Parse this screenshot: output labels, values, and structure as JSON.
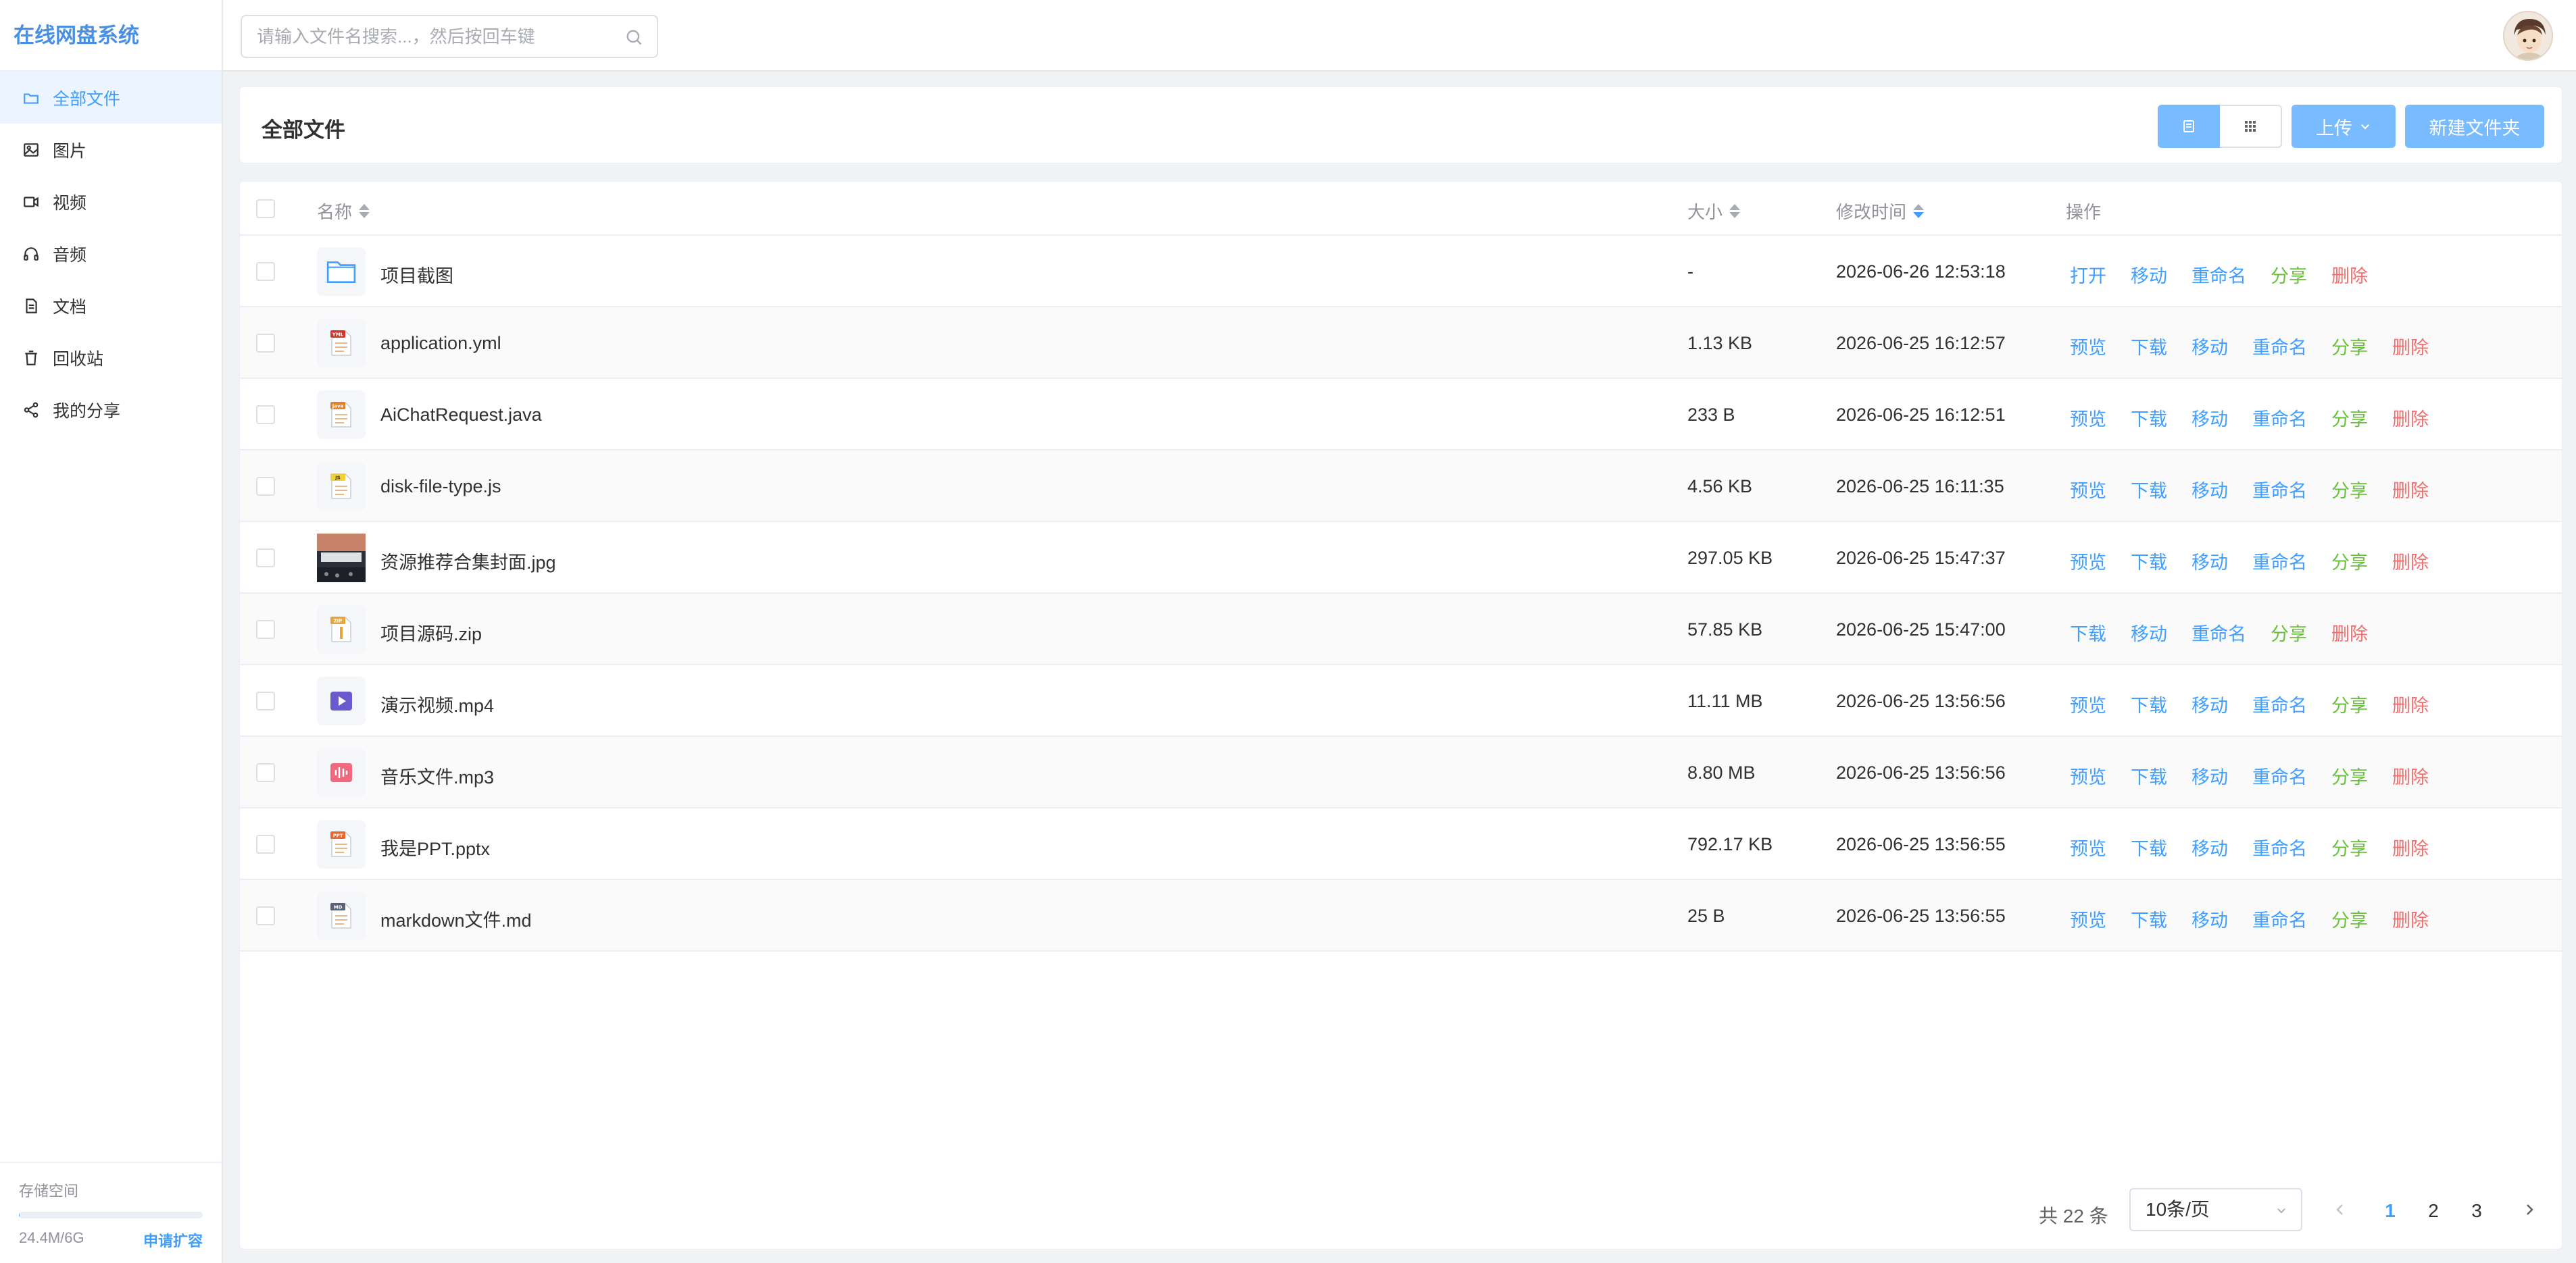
{
  "app": {
    "title": "在线网盘系统"
  },
  "sidebar": {
    "items": [
      {
        "label": "全部文件",
        "icon": "folder-icon",
        "active": true
      },
      {
        "label": "图片",
        "icon": "image-icon"
      },
      {
        "label": "视频",
        "icon": "video-icon"
      },
      {
        "label": "音频",
        "icon": "headphones-icon"
      },
      {
        "label": "文档",
        "icon": "document-icon"
      },
      {
        "label": "回收站",
        "icon": "trash-icon"
      },
      {
        "label": "我的分享",
        "icon": "share-icon"
      }
    ],
    "storage": {
      "label": "存储空间",
      "used": "24.4M/6G",
      "used_fraction": 0.004,
      "apply": "申请扩容"
    }
  },
  "header": {
    "search_placeholder": "请输入文件名搜索...，然后按回车键"
  },
  "toolbar": {
    "title": "全部文件",
    "upload_label": "上传",
    "new_folder_label": "新建文件夹",
    "view_mode": "list"
  },
  "table": {
    "columns": {
      "name": "名称",
      "size": "大小",
      "modified": "修改时间",
      "actions": "操作"
    },
    "rows": [
      {
        "name": "项目截图",
        "size": "-",
        "modified": "2026-06-26 12:53:18",
        "type": "folder",
        "actions": [
          "打开",
          "移动",
          "重命名",
          "分享",
          "删除"
        ]
      },
      {
        "name": "application.yml",
        "size": "1.13 KB",
        "modified": "2026-06-25 16:12:57",
        "type": "yml",
        "badge": "YML",
        "actions": [
          "预览",
          "下载",
          "移动",
          "重命名",
          "分享",
          "删除"
        ]
      },
      {
        "name": "AiChatRequest.java",
        "size": "233 B",
        "modified": "2026-06-25 16:12:51",
        "type": "java",
        "badge": "Java",
        "actions": [
          "预览",
          "下载",
          "移动",
          "重命名",
          "分享",
          "删除"
        ]
      },
      {
        "name": "disk-file-type.js",
        "size": "4.56 KB",
        "modified": "2026-06-25 16:11:35",
        "type": "js",
        "badge": "JS",
        "actions": [
          "预览",
          "下载",
          "移动",
          "重命名",
          "分享",
          "删除"
        ]
      },
      {
        "name": "资源推荐合集封面.jpg",
        "size": "297.05 KB",
        "modified": "2026-06-25 15:47:37",
        "type": "image",
        "actions": [
          "预览",
          "下载",
          "移动",
          "重命名",
          "分享",
          "删除"
        ]
      },
      {
        "name": "项目源码.zip",
        "size": "57.85 KB",
        "modified": "2026-06-25 15:47:00",
        "type": "zip",
        "badge": "ZIP",
        "actions": [
          "下载",
          "移动",
          "重命名",
          "分享",
          "删除"
        ]
      },
      {
        "name": "演示视频.mp4",
        "size": "11.11 MB",
        "modified": "2026-06-25 13:56:56",
        "type": "video",
        "actions": [
          "预览",
          "下载",
          "移动",
          "重命名",
          "分享",
          "删除"
        ]
      },
      {
        "name": "音乐文件.mp3",
        "size": "8.80 MB",
        "modified": "2026-06-25 13:56:56",
        "type": "audio",
        "actions": [
          "预览",
          "下载",
          "移动",
          "重命名",
          "分享",
          "删除"
        ]
      },
      {
        "name": "我是PPT.pptx",
        "size": "792.17 KB",
        "modified": "2026-06-25 13:56:55",
        "type": "ppt",
        "badge": "PPT",
        "actions": [
          "预览",
          "下载",
          "移动",
          "重命名",
          "分享",
          "删除"
        ]
      },
      {
        "name": "markdown文件.md",
        "size": "25 B",
        "modified": "2026-06-25 13:56:55",
        "type": "md",
        "badge": "MD",
        "actions": [
          "预览",
          "下载",
          "移动",
          "重命名",
          "分享",
          "删除"
        ]
      }
    ]
  },
  "pagination": {
    "total_text": "共 22 条",
    "page_size": "10条/页",
    "pages": [
      "1",
      "2",
      "3"
    ],
    "current": "1"
  },
  "colors": {
    "primary": "#409eff",
    "share": "#67c23a",
    "danger": "#f56c6c",
    "yml": "#d9342b",
    "java": "#e0832b",
    "js": "#f0d33a",
    "zip": "#e8a53a",
    "video": "#6a5acd",
    "audio": "#ef6a7e",
    "ppt": "#e8652e",
    "md": "#5a6275"
  }
}
